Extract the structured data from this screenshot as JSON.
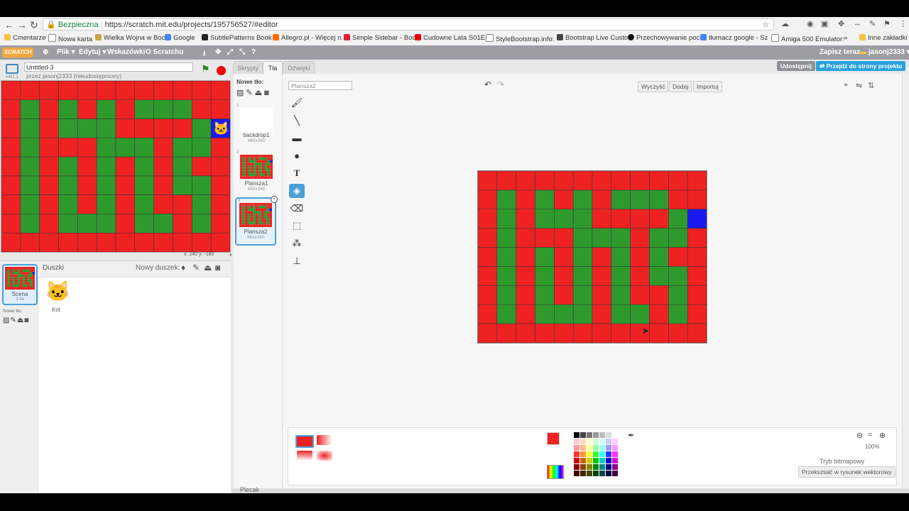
{
  "browser": {
    "secure_label": "Bezpieczna",
    "url": "https://scratch.mit.edu/projects/195756527/#editor",
    "bookmarks": [
      "Cmentarze",
      "Nowa karta",
      "Wielka Wojna w Boc",
      "Google",
      "SubtlePatterns Book",
      "Allegro.pl - Więcej n",
      "Simple Sidebar - Boc",
      "Cudowne Lata S01E",
      "StyleBootstrap.info:",
      "Bootstrap Live Custo",
      "Przechowywanie poc",
      "tłumacz google - Sz",
      "Amiga 500 Emulator:",
      "Inne zakładki"
    ],
    "more_bookmarks": "»"
  },
  "scratch_menu": {
    "logo": "SCRATCH",
    "items": [
      "Plik ▾",
      "Edytuj ▾",
      "Wskazówki",
      "O Scratchu"
    ],
    "save_now": "Zapisz teraz",
    "user": "jasonj2333 ▾"
  },
  "project": {
    "title": "Untitled-3",
    "byline": "przez jasonj2333 (nieudostępniony)",
    "version": "v461.1"
  },
  "stage": {
    "coords": "x: 240  y: -180"
  },
  "sprites": {
    "header": "Duszki",
    "new_sprite": "Nowy duszek:",
    "stage_label": "Scena",
    "stage_sub": "3 tła",
    "new_backdrop": "Nowe tło:",
    "items": [
      {
        "name": "Kot"
      }
    ]
  },
  "tabs": [
    "Skrypty",
    "Tła",
    "Dźwięki"
  ],
  "share_button": "Udostępnij",
  "project_page_button": "Przejdź do strony projektu",
  "costumes": {
    "new_backdrop": "Nowe tło:",
    "items": [
      {
        "num": "1",
        "name": "backdrop1",
        "size": "480x360"
      },
      {
        "num": "2",
        "name": "Plansza1",
        "size": "480x360"
      },
      {
        "num": "3",
        "name": "Plansza2",
        "size": "480x360"
      }
    ]
  },
  "editor": {
    "costume_name": "Plansza2",
    "clear": "Wyczyść",
    "add": "Dodaj",
    "import": "Importuj",
    "zoom": "100%",
    "mode": "Tryb bitmapowy",
    "convert": "Przekształć w rysunek wektorowy",
    "selected_color": "#ee2222"
  },
  "backpack": "Plecak",
  "maze": {
    "colors": {
      "R": "#ee2222",
      "G": "#2e9a2e",
      "B": "#1a1aee"
    },
    "rows": [
      "RRRRRRRRRRRR",
      "RGRGRGRGGGRR",
      "RGRGGGRRRRGB",
      "RGRRRGGGRGGR",
      "RGRGRGRGRGRR",
      "RGRGRGRGRGGR",
      "RGRGRGRGRRGR",
      "RGRGGGRGGRGR",
      "RRRRRRRRRRRR"
    ]
  }
}
